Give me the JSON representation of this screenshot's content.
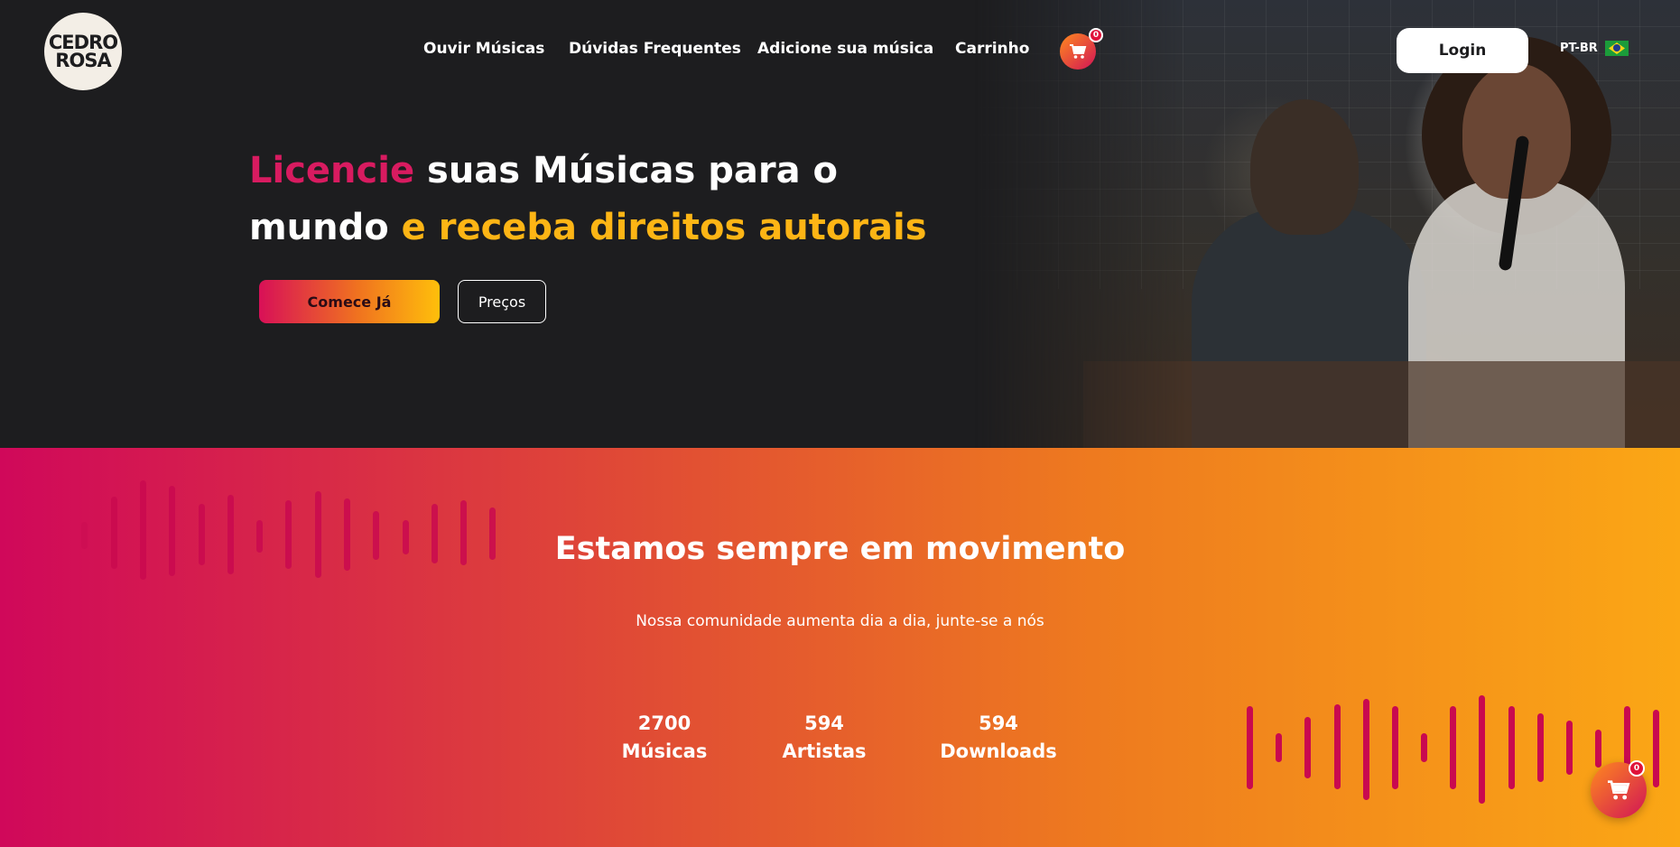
{
  "brand": {
    "logo_line1": "CEDRO",
    "logo_line2": "ROSA"
  },
  "nav": {
    "items": [
      {
        "label": "Ouvir Músicas"
      },
      {
        "label": "Dúvidas Frequentes"
      },
      {
        "label": "Adicione sua música"
      },
      {
        "label": "Carrinho"
      }
    ],
    "cart_count": "0",
    "login_label": "Login",
    "language": "PT-BR"
  },
  "hero": {
    "headline_highlight": "Licencie",
    "headline_mid": " suas Músicas para o mundo ",
    "headline_accent": "e receba direitos autorais",
    "cta_primary": "Comece Já",
    "cta_secondary": "Preços"
  },
  "stats_section": {
    "title": "Estamos sempre em movimento",
    "subtitle": "Nossa comunidade aumenta dia a dia, junte-se a nós",
    "items": [
      {
        "value": "2700",
        "label": "Músicas"
      },
      {
        "value": "594",
        "label": "Artistas"
      },
      {
        "value": "594",
        "label": "Downloads"
      }
    ]
  },
  "floating_cart": {
    "count": "0"
  },
  "colors": {
    "pink": "#d81b60",
    "gold": "#fdb515",
    "dark_bg": "#1d1d1f",
    "gradient_start": "#d0085a",
    "gradient_end": "#fba715"
  }
}
